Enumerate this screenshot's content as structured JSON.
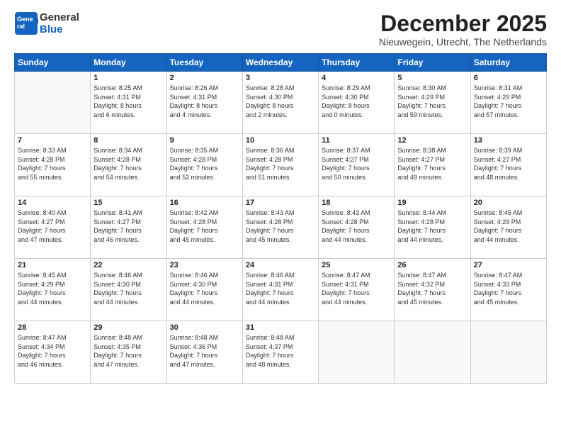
{
  "header": {
    "logo_general": "General",
    "logo_blue": "Blue",
    "month_title": "December 2025",
    "location": "Nieuwegein, Utrecht, The Netherlands"
  },
  "days_of_week": [
    "Sunday",
    "Monday",
    "Tuesday",
    "Wednesday",
    "Thursday",
    "Friday",
    "Saturday"
  ],
  "weeks": [
    [
      {
        "day": "",
        "info": ""
      },
      {
        "day": "1",
        "info": "Sunrise: 8:25 AM\nSunset: 4:31 PM\nDaylight: 8 hours\nand 6 minutes."
      },
      {
        "day": "2",
        "info": "Sunrise: 8:26 AM\nSunset: 4:31 PM\nDaylight: 8 hours\nand 4 minutes."
      },
      {
        "day": "3",
        "info": "Sunrise: 8:28 AM\nSunset: 4:30 PM\nDaylight: 8 hours\nand 2 minutes."
      },
      {
        "day": "4",
        "info": "Sunrise: 8:29 AM\nSunset: 4:30 PM\nDaylight: 8 hours\nand 0 minutes."
      },
      {
        "day": "5",
        "info": "Sunrise: 8:30 AM\nSunset: 4:29 PM\nDaylight: 7 hours\nand 59 minutes."
      },
      {
        "day": "6",
        "info": "Sunrise: 8:31 AM\nSunset: 4:29 PM\nDaylight: 7 hours\nand 57 minutes."
      }
    ],
    [
      {
        "day": "7",
        "info": "Sunrise: 8:33 AM\nSunset: 4:28 PM\nDaylight: 7 hours\nand 55 minutes."
      },
      {
        "day": "8",
        "info": "Sunrise: 8:34 AM\nSunset: 4:28 PM\nDaylight: 7 hours\nand 54 minutes."
      },
      {
        "day": "9",
        "info": "Sunrise: 8:35 AM\nSunset: 4:28 PM\nDaylight: 7 hours\nand 52 minutes."
      },
      {
        "day": "10",
        "info": "Sunrise: 8:36 AM\nSunset: 4:28 PM\nDaylight: 7 hours\nand 51 minutes."
      },
      {
        "day": "11",
        "info": "Sunrise: 8:37 AM\nSunset: 4:27 PM\nDaylight: 7 hours\nand 50 minutes."
      },
      {
        "day": "12",
        "info": "Sunrise: 8:38 AM\nSunset: 4:27 PM\nDaylight: 7 hours\nand 49 minutes."
      },
      {
        "day": "13",
        "info": "Sunrise: 8:39 AM\nSunset: 4:27 PM\nDaylight: 7 hours\nand 48 minutes."
      }
    ],
    [
      {
        "day": "14",
        "info": "Sunrise: 8:40 AM\nSunset: 4:27 PM\nDaylight: 7 hours\nand 47 minutes."
      },
      {
        "day": "15",
        "info": "Sunrise: 8:41 AM\nSunset: 4:27 PM\nDaylight: 7 hours\nand 46 minutes."
      },
      {
        "day": "16",
        "info": "Sunrise: 8:42 AM\nSunset: 4:28 PM\nDaylight: 7 hours\nand 45 minutes."
      },
      {
        "day": "17",
        "info": "Sunrise: 8:43 AM\nSunset: 4:28 PM\nDaylight: 7 hours\nand 45 minutes."
      },
      {
        "day": "18",
        "info": "Sunrise: 8:43 AM\nSunset: 4:28 PM\nDaylight: 7 hours\nand 44 minutes."
      },
      {
        "day": "19",
        "info": "Sunrise: 8:44 AM\nSunset: 4:28 PM\nDaylight: 7 hours\nand 44 minutes."
      },
      {
        "day": "20",
        "info": "Sunrise: 8:45 AM\nSunset: 4:29 PM\nDaylight: 7 hours\nand 44 minutes."
      }
    ],
    [
      {
        "day": "21",
        "info": "Sunrise: 8:45 AM\nSunset: 4:29 PM\nDaylight: 7 hours\nand 44 minutes."
      },
      {
        "day": "22",
        "info": "Sunrise: 8:46 AM\nSunset: 4:30 PM\nDaylight: 7 hours\nand 44 minutes."
      },
      {
        "day": "23",
        "info": "Sunrise: 8:46 AM\nSunset: 4:30 PM\nDaylight: 7 hours\nand 44 minutes."
      },
      {
        "day": "24",
        "info": "Sunrise: 8:46 AM\nSunset: 4:31 PM\nDaylight: 7 hours\nand 44 minutes."
      },
      {
        "day": "25",
        "info": "Sunrise: 8:47 AM\nSunset: 4:31 PM\nDaylight: 7 hours\nand 44 minutes."
      },
      {
        "day": "26",
        "info": "Sunrise: 8:47 AM\nSunset: 4:32 PM\nDaylight: 7 hours\nand 45 minutes."
      },
      {
        "day": "27",
        "info": "Sunrise: 8:47 AM\nSunset: 4:33 PM\nDaylight: 7 hours\nand 45 minutes."
      }
    ],
    [
      {
        "day": "28",
        "info": "Sunrise: 8:47 AM\nSunset: 4:34 PM\nDaylight: 7 hours\nand 46 minutes."
      },
      {
        "day": "29",
        "info": "Sunrise: 8:48 AM\nSunset: 4:35 PM\nDaylight: 7 hours\nand 47 minutes."
      },
      {
        "day": "30",
        "info": "Sunrise: 8:48 AM\nSunset: 4:36 PM\nDaylight: 7 hours\nand 47 minutes."
      },
      {
        "day": "31",
        "info": "Sunrise: 8:48 AM\nSunset: 4:37 PM\nDaylight: 7 hours\nand 48 minutes."
      },
      {
        "day": "",
        "info": ""
      },
      {
        "day": "",
        "info": ""
      },
      {
        "day": "",
        "info": ""
      }
    ]
  ]
}
